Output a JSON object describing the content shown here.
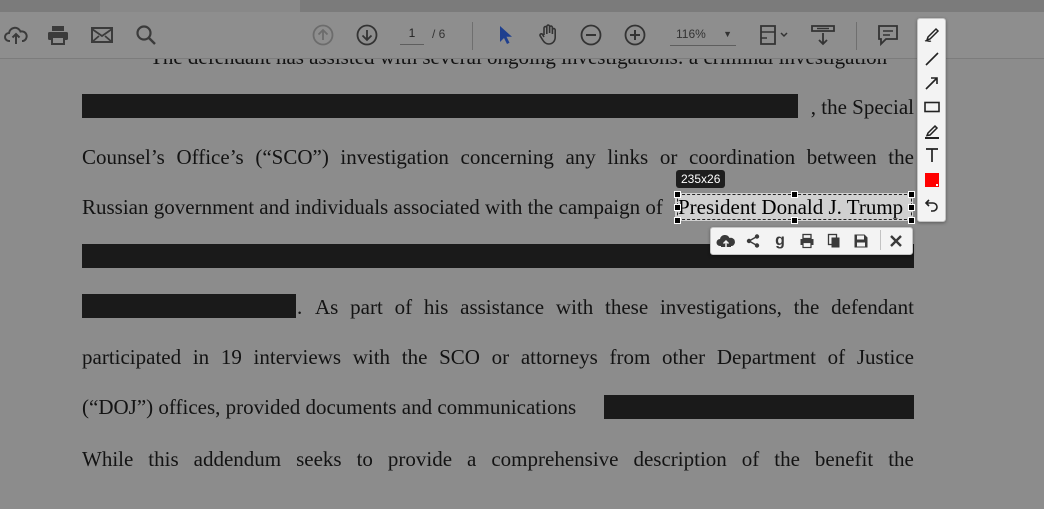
{
  "toolbar": {
    "current_page": "1",
    "total_pages": "/ 6",
    "zoom": "116%"
  },
  "document": {
    "lines": [
      "The defendant has assisted with several ongoing investigations: a criminal investigation",
      ", the Special",
      [
        "Counsel’s",
        "Office’s",
        "(“SCO”)",
        "investigation",
        "concerning",
        "any",
        "links",
        "or",
        "coordination",
        "between",
        "the"
      ],
      "Russian government and individuals associated with the campaign of",
      [
        "As",
        "part",
        "of",
        "his",
        "assistance",
        "with",
        "these",
        "investigations,",
        "the",
        "defendant"
      ],
      [
        "participated",
        "in",
        "19",
        "interviews",
        "with",
        "the",
        "SCO",
        "or",
        "attorneys",
        "from",
        "other",
        "Department",
        "of",
        "Justice"
      ],
      "(“DOJ”) offices, provided documents and communications",
      [
        "While",
        "this",
        "addendum",
        "seeks",
        "to",
        "provide",
        "a",
        "comprehensive",
        "description",
        "of",
        "the",
        "benefit",
        "the"
      ]
    ],
    "selected_text": "President Donald J. Trump",
    "line5_prefix": "."
  },
  "selection": {
    "size_label": "235x26"
  },
  "palette": {
    "color": "#ff0000",
    "tools": [
      "freehand-pencil-icon",
      "line-icon",
      "arrow-icon",
      "rectangle-icon",
      "highlighter-icon",
      "text-tool-icon",
      "color-swatch",
      "undo-icon"
    ]
  },
  "actionbar": {
    "tools": [
      "cloud-upload-icon",
      "share-icon",
      "google-search-icon",
      "print-icon",
      "copy-icon",
      "save-icon",
      "close-icon"
    ],
    "google_label": "g"
  }
}
